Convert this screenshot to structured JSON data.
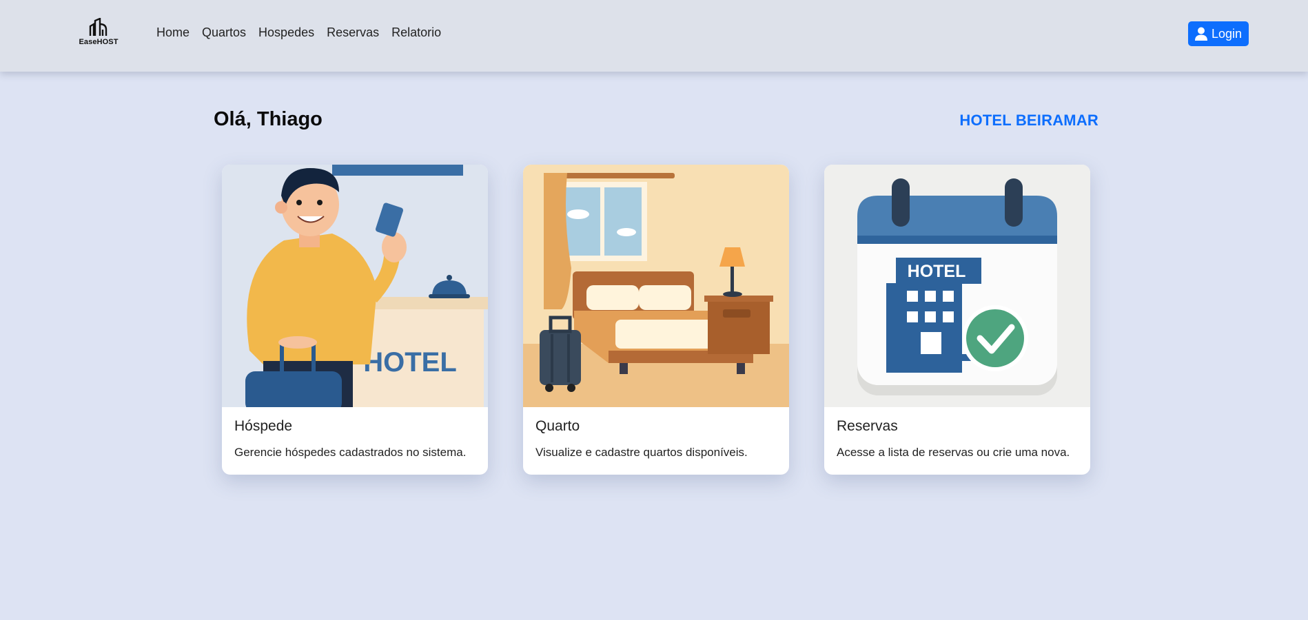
{
  "brand": {
    "name": "EaseHOST",
    "icon": "buildings-icon"
  },
  "nav": {
    "links": [
      "Home",
      "Quartos",
      "Hospedes",
      "Reservas",
      "Relatorio"
    ],
    "login_label": "Login",
    "login_icon": "user-icon"
  },
  "header": {
    "greeting": "Olá, Thiago",
    "hotel_name": "HOTEL BEIRAMAR"
  },
  "cards": [
    {
      "title": "Hóspede",
      "text": "Gerencie hóspedes cadastrados no sistema.",
      "image_label": "HOTEL"
    },
    {
      "title": "Quarto",
      "text": "Visualize e cadastre quartos disponíveis."
    },
    {
      "title": "Reservas",
      "text": "Acesse a lista de reservas ou crie uma nova.",
      "image_label": "HOTEL"
    }
  ],
  "colors": {
    "accent": "#0d6efd",
    "background": "#dde3f3",
    "navbar": "#dde1ea"
  }
}
